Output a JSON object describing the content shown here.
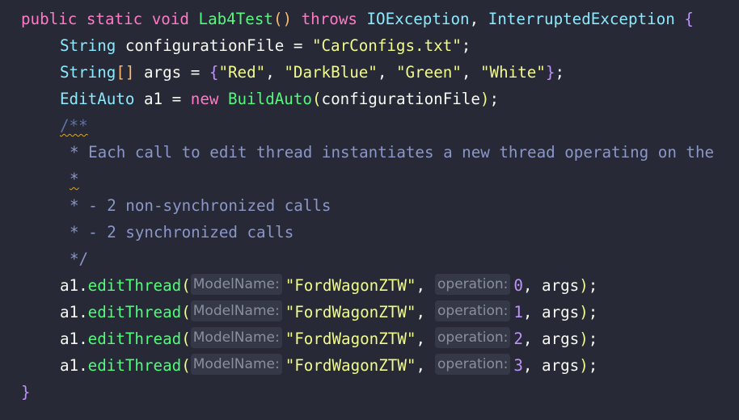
{
  "code": {
    "signature": {
      "public": "public",
      "static": "static",
      "void": "void",
      "method_name": "Lab4Test",
      "parens": "()",
      "throws": "throws",
      "exception1": "IOException",
      "comma": ",",
      "exception2": "InterruptedException",
      "open_brace": "{"
    },
    "line_config": {
      "type": "String",
      "name": "configurationFile",
      "eq": "=",
      "value": "\"CarConfigs.txt\"",
      "semi": ";"
    },
    "line_args": {
      "type": "String",
      "brackets": "[]",
      "name": "args",
      "eq": "=",
      "open": "{",
      "v1": "\"Red\"",
      "v2": "\"DarkBlue\"",
      "v3": "\"Green\"",
      "v4": "\"White\"",
      "sep": ",",
      "close": "}",
      "semi": ";"
    },
    "line_edit": {
      "type": "EditAuto",
      "name": "a1",
      "eq": "=",
      "new": "new",
      "ctor": "BuildAuto",
      "open": "(",
      "arg": "configurationFile",
      "close": ")",
      "semi": ";"
    },
    "comment": {
      "open": "/**",
      "line1": "* Each call to edit thread instantiates a new thread operating on the",
      "line2": "*",
      "line3": "* - 2 non-synchronized calls",
      "line4": "* - 2 synchronized calls",
      "close": "*/"
    },
    "calls": [
      {
        "receiver": "a1",
        "dot": ".",
        "method": "editThread",
        "open": "(",
        "hint1": "ModelName:",
        "model": "\"FordWagonZTW\"",
        "comma": ",",
        "hint2": "operation:",
        "op": "0",
        "tail": ", args",
        "close": ")",
        "semi": ";"
      },
      {
        "receiver": "a1",
        "dot": ".",
        "method": "editThread",
        "open": "(",
        "hint1": "ModelName:",
        "model": "\"FordWagonZTW\"",
        "comma": ",",
        "hint2": "operation:",
        "op": "1",
        "tail": ", args",
        "close": ")",
        "semi": ";"
      },
      {
        "receiver": "a1",
        "dot": ".",
        "method": "editThread",
        "open": "(",
        "hint1": "ModelName:",
        "model": "\"FordWagonZTW\"",
        "comma": ",",
        "hint2": "operation:",
        "op": "2",
        "tail": ", args",
        "close": ")",
        "semi": ";"
      },
      {
        "receiver": "a1",
        "dot": ".",
        "method": "editThread",
        "open": "(",
        "hint1": "ModelName:",
        "model": "\"FordWagonZTW\"",
        "comma": ",",
        "hint2": "operation:",
        "op": "3",
        "tail": ", args",
        "close": ")",
        "semi": ";"
      }
    ],
    "close_brace": "}"
  },
  "colors": {
    "background": "#272a36",
    "keyword": "#ff79c6",
    "type": "#8be9fd",
    "function": "#50fa7b",
    "string": "#f1fa8c",
    "number": "#bd93f9",
    "comment": "#6272a4",
    "hint_bg": "#353846",
    "hint_text": "#8a8f9e",
    "warning_underline": "#d7a62f"
  }
}
